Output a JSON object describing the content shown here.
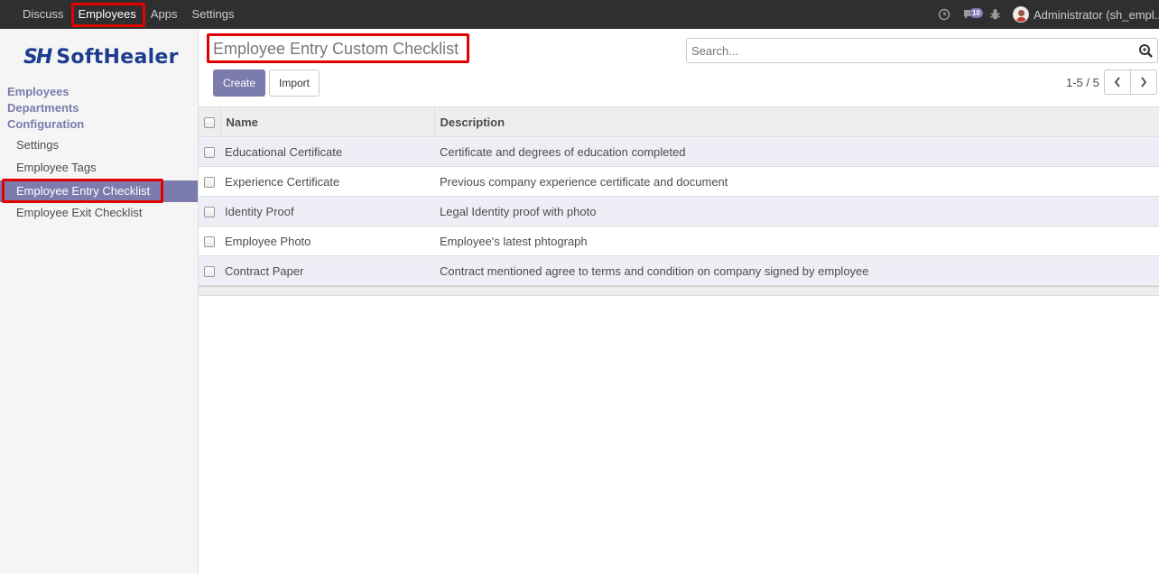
{
  "topbar": {
    "menu": [
      {
        "label": "Discuss",
        "active": false
      },
      {
        "label": "Employees",
        "active": true
      },
      {
        "label": "Apps",
        "active": false
      },
      {
        "label": "Settings",
        "active": false
      }
    ],
    "icons": [
      "clock-icon",
      "chat-icon",
      "bug-icon"
    ],
    "chat_badge": "10",
    "user_name": "Administrator (sh_empl..."
  },
  "sidebar": {
    "logo_mark": "SH",
    "logo_text": "SoftHealer",
    "sections": [
      "Employees",
      "Departments",
      "Configuration"
    ],
    "items": [
      {
        "label": "Settings",
        "active": false
      },
      {
        "label": "Employee Tags",
        "active": false
      },
      {
        "label": "Employee Entry Checklist",
        "active": true
      },
      {
        "label": "Employee Exit Checklist",
        "active": false
      }
    ]
  },
  "control_panel": {
    "title": "Employee Entry Custom Checklist",
    "search_placeholder": "Search...",
    "create_label": "Create",
    "import_label": "Import",
    "pager_text": "1-5 / 5"
  },
  "list": {
    "headers": {
      "name": "Name",
      "description": "Description"
    },
    "rows": [
      {
        "name": "Educational Certificate",
        "description": "Certificate and degrees of education completed"
      },
      {
        "name": "Experience Certificate",
        "description": "Previous company experience certificate and document"
      },
      {
        "name": "Identity Proof",
        "description": "Legal Identity proof with photo"
      },
      {
        "name": "Employee Photo",
        "description": "Employee's latest phtograph"
      },
      {
        "name": "Contract Paper",
        "description": "Contract mentioned agree to terms and condition on company signed by employee"
      }
    ]
  },
  "colors": {
    "accent": "#7c7bad",
    "navbar": "#2f2f2f",
    "highlight_box": "#e30000",
    "logo": "#1c3d8f"
  }
}
